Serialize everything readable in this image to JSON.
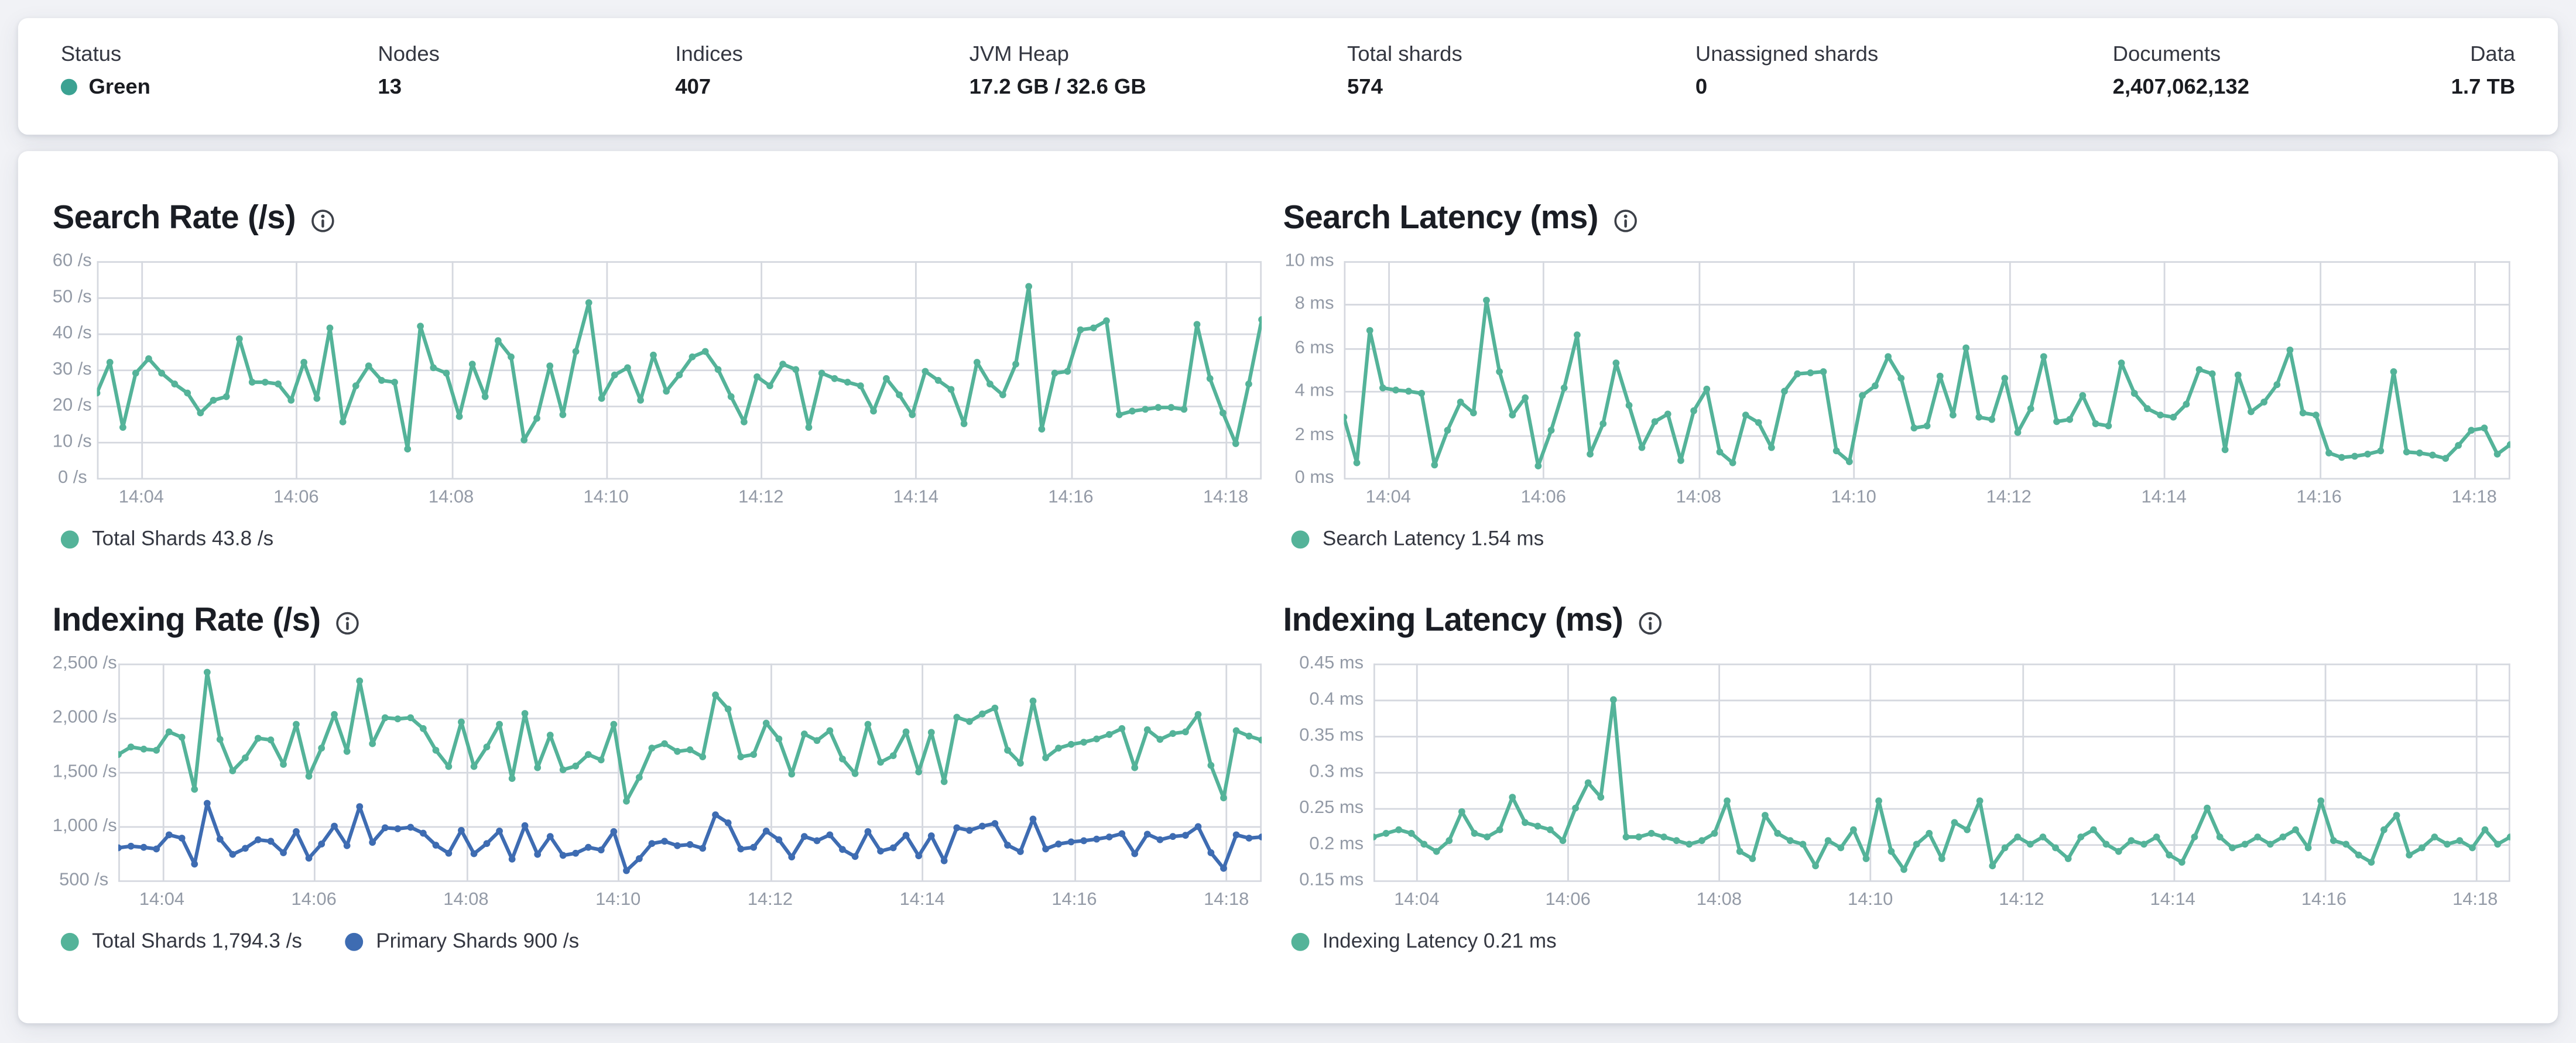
{
  "header": {
    "stats": [
      {
        "id": "status",
        "label": "Status",
        "value": "Green",
        "dot_color": "#3ba292"
      },
      {
        "id": "nodes",
        "label": "Nodes",
        "value": "13"
      },
      {
        "id": "indices",
        "label": "Indices",
        "value": "407"
      },
      {
        "id": "jvm-heap",
        "label": "JVM Heap",
        "value": "17.2 GB / 32.6 GB"
      },
      {
        "id": "total-shards",
        "label": "Total shards",
        "value": "574"
      },
      {
        "id": "unassigned-shards",
        "label": "Unassigned shards",
        "value": "0"
      },
      {
        "id": "documents",
        "label": "Documents",
        "value": "2,407,062,132"
      },
      {
        "id": "data",
        "label": "Data",
        "value": "1.7 TB",
        "align": "right"
      }
    ]
  },
  "colors": {
    "teal": "#54b399",
    "blue": "#3e6cb2",
    "grid": "#d5d8df",
    "axis_text": "#939aa6"
  },
  "x_ticks": [
    {
      "frac": 0.0381,
      "label": "14:04"
    },
    {
      "frac": 0.1711,
      "label": "14:06"
    },
    {
      "frac": 0.3041,
      "label": "14:08"
    },
    {
      "frac": 0.4371,
      "label": "14:10"
    },
    {
      "frac": 0.5701,
      "label": "14:12"
    },
    {
      "frac": 0.7031,
      "label": "14:14"
    },
    {
      "frac": 0.8361,
      "label": "14:16"
    },
    {
      "frac": 0.9691,
      "label": "14:18"
    }
  ],
  "charts": [
    {
      "id": "search-rate",
      "title": "Search Rate (/s)",
      "type": "line",
      "y_min": 0,
      "y_max": 60,
      "y_ticks": [
        {
          "v": 60,
          "label": "60 /s"
        },
        {
          "v": 50,
          "label": "50 /s"
        },
        {
          "v": 40,
          "label": "40 /s"
        },
        {
          "v": 30,
          "label": "30 /s"
        },
        {
          "v": 20,
          "label": "20 /s"
        },
        {
          "v": 10,
          "label": "10 /s"
        },
        {
          "v": 0,
          "label": "0 /s"
        }
      ],
      "series": [
        {
          "name": "Total Shards",
          "color": "#54b399",
          "legend": "Total Shards 43.8 /s",
          "current": "43.8 /s",
          "values": [
            23.5,
            32,
            14,
            29,
            33,
            29,
            26,
            23.5,
            18,
            21.5,
            22.5,
            38.5,
            26.5,
            26.5,
            26,
            21.5,
            32,
            22,
            41.5,
            15.5,
            25.5,
            31,
            27,
            26.5,
            8,
            42,
            30.5,
            29,
            17,
            31.5,
            22.5,
            38,
            33.5,
            10.5,
            16.5,
            31,
            17.5,
            35,
            48.5,
            22,
            28.5,
            30.5,
            21.5,
            34,
            24,
            28.5,
            33.5,
            35,
            30,
            22.5,
            15.5,
            28,
            25.5,
            31.5,
            30,
            14,
            29,
            27.5,
            26.5,
            25.5,
            18.5,
            27.5,
            23,
            17.5,
            29.5,
            27,
            24.5,
            15,
            32,
            26,
            23,
            31.5,
            53,
            13.5,
            29,
            29.5,
            41,
            41.5,
            43.5,
            17.5,
            18.5,
            19,
            19.5,
            19.5,
            19,
            42.5,
            27.5,
            18,
            9.5,
            26,
            43.8
          ]
        }
      ]
    },
    {
      "id": "search-latency",
      "title": "Search Latency (ms)",
      "type": "line",
      "y_min": 0,
      "y_max": 10,
      "y_ticks": [
        {
          "v": 10,
          "label": "10 ms"
        },
        {
          "v": 8,
          "label": "8 ms"
        },
        {
          "v": 6,
          "label": "6 ms"
        },
        {
          "v": 4,
          "label": "4 ms"
        },
        {
          "v": 2,
          "label": "2 ms"
        },
        {
          "v": 0,
          "label": "0 ms"
        }
      ],
      "series": [
        {
          "name": "Search Latency",
          "color": "#54b399",
          "legend": "Search Latency 1.54 ms",
          "current": "1.54 ms",
          "values": [
            2.8,
            0.7,
            6.8,
            4.15,
            4.05,
            4.0,
            3.9,
            0.6,
            2.2,
            3.5,
            3.0,
            8.2,
            4.9,
            2.9,
            3.7,
            0.55,
            2.2,
            4.15,
            6.6,
            1.1,
            2.5,
            5.3,
            3.35,
            1.4,
            2.6,
            2.95,
            0.8,
            3.1,
            4.1,
            1.2,
            0.7,
            2.9,
            2.55,
            1.4,
            4.0,
            4.8,
            4.85,
            4.9,
            1.25,
            0.75,
            3.8,
            4.25,
            5.6,
            4.6,
            2.3,
            2.4,
            4.7,
            2.9,
            6.0,
            2.8,
            2.7,
            4.6,
            2.1,
            3.2,
            5.6,
            2.6,
            2.7,
            3.8,
            2.5,
            2.4,
            5.3,
            3.9,
            3.2,
            2.9,
            2.8,
            3.4,
            5.0,
            4.8,
            1.3,
            4.75,
            3.05,
            3.5,
            4.3,
            5.9,
            3.0,
            2.9,
            1.15,
            0.95,
            1.0,
            1.1,
            1.25,
            4.9,
            1.2,
            1.15,
            1.05,
            0.9,
            1.5,
            2.2,
            2.3,
            1.1,
            1.54
          ]
        }
      ]
    },
    {
      "id": "indexing-rate",
      "title": "Indexing Rate (/s)",
      "type": "line",
      "y_min": 500,
      "y_max": 2500,
      "y_ticks": [
        {
          "v": 2500,
          "label": "2,500 /s"
        },
        {
          "v": 2000,
          "label": "2,000 /s"
        },
        {
          "v": 1500,
          "label": "1,500 /s"
        },
        {
          "v": 1000,
          "label": "1,000 /s"
        },
        {
          "v": 500,
          "label": "500 /s"
        }
      ],
      "series": [
        {
          "name": "Total Shards",
          "color": "#54b399",
          "legend": "Total Shards 1,794.3 /s",
          "current": "1,794.3 /s",
          "values": [
            1660,
            1730,
            1710,
            1700,
            1870,
            1820,
            1340,
            2420,
            1800,
            1510,
            1630,
            1810,
            1795,
            1570,
            1940,
            1460,
            1720,
            2030,
            1690,
            2340,
            1760,
            2000,
            1990,
            2000,
            1900,
            1700,
            1550,
            1960,
            1550,
            1730,
            1940,
            1440,
            2040,
            1540,
            1840,
            1520,
            1555,
            1660,
            1610,
            1940,
            1230,
            1450,
            1720,
            1760,
            1690,
            1705,
            1640,
            2210,
            2080,
            1640,
            1660,
            1950,
            1805,
            1480,
            1850,
            1790,
            1880,
            1620,
            1485,
            1940,
            1590,
            1650,
            1870,
            1500,
            1865,
            1410,
            2005,
            1965,
            2035,
            2090,
            1700,
            1580,
            2155,
            1630,
            1720,
            1755,
            1775,
            1805,
            1845,
            1900,
            1540,
            1890,
            1800,
            1855,
            1870,
            2030,
            1560,
            1260,
            1880,
            1830,
            1794.3
          ]
        },
        {
          "name": "Primary Shards",
          "color": "#3e6cb2",
          "legend": "Primary Shards 900 /s",
          "current": "900 /s",
          "values": [
            800,
            815,
            805,
            790,
            920,
            890,
            650,
            1210,
            880,
            740,
            795,
            875,
            860,
            755,
            950,
            705,
            835,
            1000,
            820,
            1180,
            850,
            985,
            975,
            990,
            935,
            825,
            750,
            960,
            745,
            840,
            955,
            695,
            1005,
            740,
            905,
            730,
            750,
            805,
            780,
            950,
            590,
            700,
            840,
            860,
            820,
            830,
            795,
            1105,
            1030,
            790,
            805,
            955,
            875,
            715,
            905,
            865,
            920,
            785,
            720,
            950,
            770,
            800,
            915,
            725,
            910,
            680,
            985,
            960,
            1000,
            1025,
            825,
            765,
            1065,
            790,
            835,
            855,
            865,
            880,
            900,
            930,
            745,
            925,
            875,
            905,
            915,
            995,
            755,
            610,
            920,
            890,
            900
          ]
        }
      ]
    },
    {
      "id": "indexing-latency",
      "title": "Indexing Latency (ms)",
      "type": "line",
      "y_min": 0.15,
      "y_max": 0.45,
      "y_ticks": [
        {
          "v": 0.45,
          "label": "0.45 ms"
        },
        {
          "v": 0.4,
          "label": "0.4 ms"
        },
        {
          "v": 0.35,
          "label": "0.35 ms"
        },
        {
          "v": 0.3,
          "label": "0.3 ms"
        },
        {
          "v": 0.25,
          "label": "0.25 ms"
        },
        {
          "v": 0.2,
          "label": "0.2 ms"
        },
        {
          "v": 0.15,
          "label": "0.15 ms"
        }
      ],
      "series": [
        {
          "name": "Indexing Latency",
          "color": "#54b399",
          "legend": "Indexing Latency 0.21 ms",
          "current": "0.21 ms",
          "values": [
            0.21,
            0.215,
            0.22,
            0.215,
            0.2,
            0.19,
            0.205,
            0.245,
            0.215,
            0.21,
            0.22,
            0.265,
            0.23,
            0.225,
            0.22,
            0.205,
            0.25,
            0.285,
            0.265,
            0.4,
            0.21,
            0.21,
            0.215,
            0.21,
            0.205,
            0.2,
            0.205,
            0.215,
            0.26,
            0.19,
            0.18,
            0.24,
            0.215,
            0.205,
            0.2,
            0.17,
            0.205,
            0.195,
            0.22,
            0.18,
            0.26,
            0.19,
            0.165,
            0.2,
            0.215,
            0.18,
            0.23,
            0.22,
            0.26,
            0.17,
            0.195,
            0.21,
            0.2,
            0.21,
            0.195,
            0.18,
            0.21,
            0.22,
            0.2,
            0.19,
            0.205,
            0.2,
            0.21,
            0.185,
            0.175,
            0.21,
            0.25,
            0.21,
            0.195,
            0.2,
            0.21,
            0.2,
            0.21,
            0.22,
            0.195,
            0.26,
            0.205,
            0.2,
            0.185,
            0.175,
            0.22,
            0.24,
            0.185,
            0.195,
            0.21,
            0.2,
            0.205,
            0.195,
            0.22,
            0.2,
            0.21
          ]
        }
      ]
    }
  ]
}
